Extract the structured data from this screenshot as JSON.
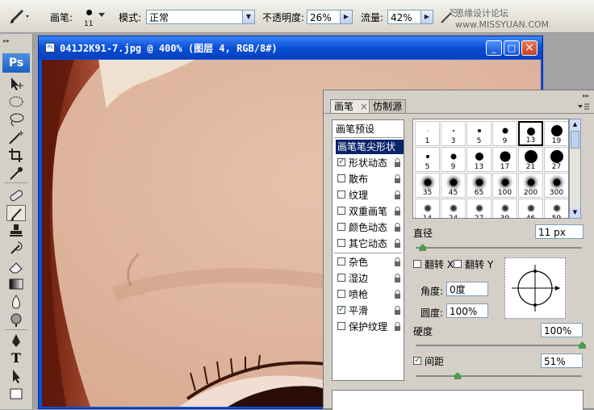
{
  "options_bar": {
    "brush_label": "画笔:",
    "brush_size": "11",
    "mode_label": "模式:",
    "mode_value": "正常",
    "opacity_label": "不透明度:",
    "opacity_value": "26%",
    "flow_label": "流量:",
    "flow_value": "42%",
    "watermark": "思缘设计论坛 www.MISSYUAN.COM"
  },
  "document": {
    "title": "041J2K91-7.jpg @ 400% (图层 4, RGB/8#)",
    "minimize": "_",
    "maximize": "□",
    "close": "×"
  },
  "toolbox": {
    "ps_logo": "Ps"
  },
  "panel": {
    "tabs": [
      {
        "label": "画笔",
        "close": "×"
      },
      {
        "label": "仿制源"
      }
    ],
    "presets_label": "画笔预设",
    "options": [
      {
        "label": "画笔笔尖形状",
        "checkbox": false,
        "selected": true
      },
      {
        "label": "形状动态",
        "checked": true
      },
      {
        "label": "散布",
        "checked": false
      },
      {
        "label": "纹理",
        "checked": false
      },
      {
        "label": "双重画笔",
        "checked": false
      },
      {
        "label": "颜色动态",
        "checked": false
      },
      {
        "label": "其它动态",
        "checked": false
      },
      {
        "label": "杂色",
        "checked": false
      },
      {
        "label": "湿边",
        "checked": false
      },
      {
        "label": "喷枪",
        "checked": false
      },
      {
        "label": "平滑",
        "checked": true
      },
      {
        "label": "保护纹理",
        "checked": false
      }
    ],
    "brush_sizes": [
      "1",
      "3",
      "5",
      "9",
      "13",
      "19",
      "5",
      "9",
      "13",
      "17",
      "21",
      "27",
      "35",
      "45",
      "65",
      "100",
      "200",
      "300",
      "14",
      "24",
      "27",
      "39",
      "46",
      "59"
    ],
    "selected_brush_index": 4,
    "diameter_label": "直径",
    "diameter_value": "11 px",
    "flip_x": "翻转 X",
    "flip_y": "翻转 Y",
    "angle_label": "角度:",
    "angle_value": "0度",
    "roundness_label": "圆度:",
    "roundness_value": "100%",
    "hardness_label": "硬度",
    "hardness_value": "100%",
    "spacing_label": "间距",
    "spacing_checked": true,
    "spacing_value": "51%",
    "diameter_slider_fraction": 0.04,
    "hardness_slider_fraction": 1.0,
    "spacing_slider_fraction": 0.25
  },
  "colors": {
    "title_bar": "#0b4fd6",
    "panel_bg": "#d4d0c8",
    "selection": "#0a246a",
    "skin": "#e0b8a2"
  }
}
